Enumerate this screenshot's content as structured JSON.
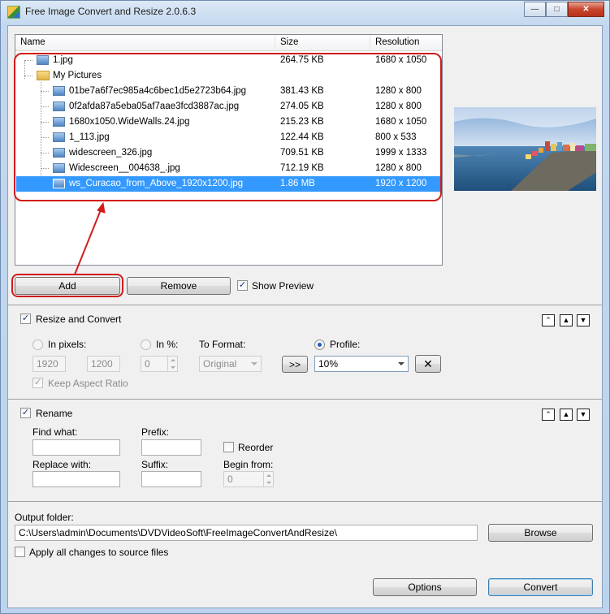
{
  "window": {
    "title": "Free Image Convert and Resize 2.0.6.3",
    "controls": {
      "minimize": "—",
      "maximize": "□",
      "close": "✕"
    }
  },
  "filelist": {
    "columns": {
      "name": "Name",
      "size": "Size",
      "resolution": "Resolution"
    },
    "rows": [
      {
        "name": "1.jpg",
        "size": "264.75 KB",
        "resolution": "1680 x 1050",
        "type": "file",
        "level": 0
      },
      {
        "name": "My Pictures",
        "size": "",
        "resolution": "",
        "type": "folder",
        "level": 0
      },
      {
        "name": "01be7a6f7ec985a4c6bec1d5e2723b64.jpg",
        "size": "381.43 KB",
        "resolution": "1280 x 800",
        "type": "file",
        "level": 1
      },
      {
        "name": "0f2afda87a5eba05af7aae3fcd3887ac.jpg",
        "size": "274.05 KB",
        "resolution": "1280 x 800",
        "type": "file",
        "level": 1
      },
      {
        "name": "1680x1050.WideWalls.24.jpg",
        "size": "215.23 KB",
        "resolution": "1680 x 1050",
        "type": "file",
        "level": 1
      },
      {
        "name": "1_113.jpg",
        "size": "122.44 KB",
        "resolution": "800 x 533",
        "type": "file",
        "level": 1
      },
      {
        "name": "widescreen_326.jpg",
        "size": "709.51 KB",
        "resolution": "1999 x 1333",
        "type": "file",
        "level": 1
      },
      {
        "name": "Widescreen__004638_.jpg",
        "size": "712.19 KB",
        "resolution": "1280 x 800",
        "type": "file",
        "level": 1
      },
      {
        "name": "ws_Curacao_from_Above_1920x1200.jpg",
        "size": "1.86 MB",
        "resolution": "1920 x 1200",
        "type": "file",
        "level": 1,
        "selected": true
      }
    ]
  },
  "actions": {
    "add": "Add",
    "remove": "Remove",
    "show_preview": "Show Preview",
    "show_preview_checked": true
  },
  "resize": {
    "title": "Resize and Convert",
    "enabled": true,
    "in_pixels": "In pixels:",
    "width": "1920",
    "height": "1200",
    "in_percent": "In %:",
    "percent": "0",
    "to_format": "To Format:",
    "format": "Original",
    "arrow_button": ">>",
    "profile": "Profile:",
    "profile_value": "10%",
    "delete_icon": "✕",
    "keep_aspect": "Keep Aspect Ratio"
  },
  "rename": {
    "title": "Rename",
    "enabled": true,
    "find_what": "Find what:",
    "find_value": "",
    "prefix": "Prefix:",
    "prefix_value": "",
    "reorder": "Reorder",
    "replace_with": "Replace with:",
    "replace_value": "",
    "suffix": "Suffix:",
    "suffix_value": "",
    "begin_from": "Begin from:",
    "begin_value": "0"
  },
  "section_buttons": {
    "collapse_all": "⌃⌃",
    "up": "▲",
    "down": "▼"
  },
  "output": {
    "label": "Output folder:",
    "path": "C:\\Users\\admin\\Documents\\DVDVideoSoft\\FreeImageConvertAndResize\\",
    "browse": "Browse",
    "apply_source": "Apply all changes to source files"
  },
  "bottom": {
    "options": "Options",
    "convert": "Convert"
  },
  "colors": {
    "selection": "#3399ff",
    "annotation": "#d21b1b"
  }
}
